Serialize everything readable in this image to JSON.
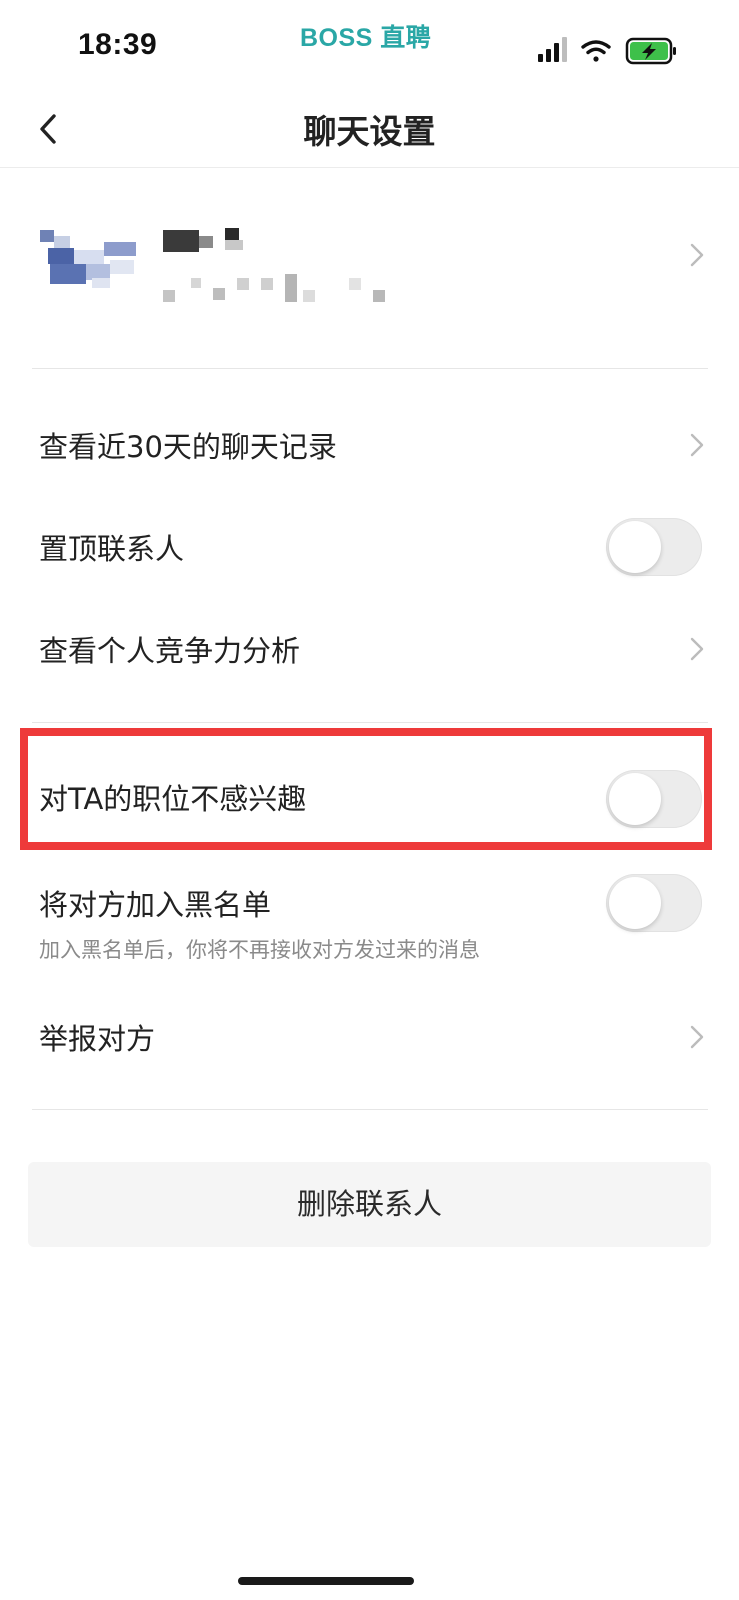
{
  "status_bar": {
    "time": "18:39",
    "brand": "BOSS 直聘",
    "icons": [
      "signal-icon",
      "wifi-icon",
      "battery-charging-icon"
    ]
  },
  "nav": {
    "title": "聊天设置",
    "back_icon": "chevron-left-icon"
  },
  "settings": {
    "chat_history": "查看近30天的聊天记录",
    "pin_contact": "置顶联系人",
    "competitiveness": "查看个人竞争力分析",
    "not_interested": "对TA的职位不感兴趣",
    "blacklist": "将对方加入黑名单",
    "blacklist_desc": "加入黑名单后，你将不再接收对方发过来的消息",
    "report": "举报对方"
  },
  "toggles": {
    "pin_contact": false,
    "not_interested": false,
    "blacklist": false
  },
  "actions": {
    "delete_contact": "删除联系人"
  },
  "colors": {
    "brand": "#2aa7a6",
    "highlight": "#ee3a3a",
    "battery": "#3ec04a"
  }
}
